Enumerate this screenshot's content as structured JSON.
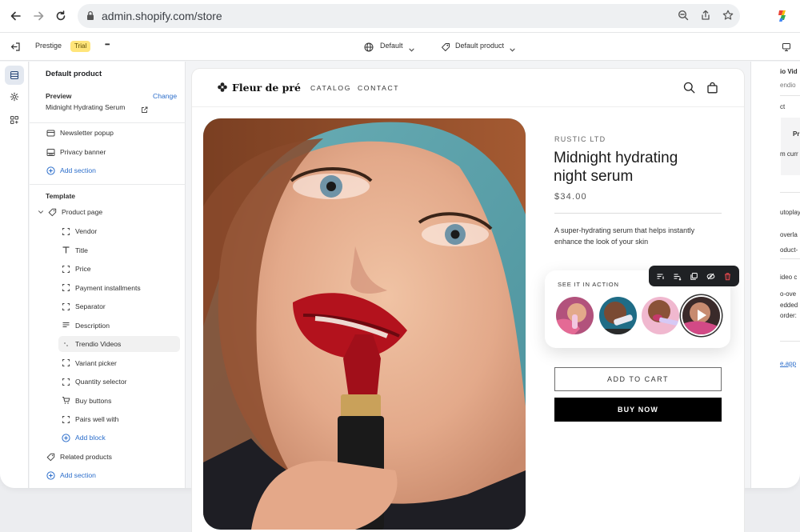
{
  "browser": {
    "url": "admin.shopify.com/store"
  },
  "toolbar": {
    "store_name": "Prestige",
    "trial_badge": "Trial",
    "more_label": "•••",
    "theme_select": "Default",
    "template_select": "Default product"
  },
  "sidebar": {
    "title": "Default product",
    "preview_label": "Preview",
    "change_link": "Change",
    "preview_product": "Midnight Hydrating Serum",
    "header_items": [
      {
        "label": "Newsletter popup",
        "icon": "popup-icon"
      },
      {
        "label": "Privacy banner",
        "icon": "banner-icon"
      }
    ],
    "add_section_1": "Add section",
    "template_heading": "Template",
    "product_page": "Product page",
    "blocks": [
      {
        "label": "Vendor",
        "icon": "block-frame-icon"
      },
      {
        "label": "Title",
        "icon": "text-icon"
      },
      {
        "label": "Price",
        "icon": "block-frame-icon"
      },
      {
        "label": "Payment installments",
        "icon": "block-frame-icon"
      },
      {
        "label": "Separator",
        "icon": "block-frame-icon"
      },
      {
        "label": "Description",
        "icon": "paragraph-icon"
      },
      {
        "label": "Trendio Videos",
        "icon": "app-block-icon",
        "selected": true
      },
      {
        "label": "Variant picker",
        "icon": "block-frame-icon"
      },
      {
        "label": "Quantity selector",
        "icon": "block-frame-icon"
      },
      {
        "label": "Buy buttons",
        "icon": "cart-icon"
      },
      {
        "label": "Pairs well with",
        "icon": "block-frame-icon"
      }
    ],
    "add_block": "Add block",
    "related_products": "Related products",
    "add_section_2": "Add section"
  },
  "store": {
    "brand": "Fleur de pré",
    "nav": [
      "CATALOG",
      "CONTACT"
    ],
    "vendor": "RUSTIC LTD",
    "title": "Midnight hydrating night serum",
    "price": "$34.00",
    "description": "A super-hydrating serum that helps instantly enhance the look of your skin",
    "videos_title": "SEE IT IN ACTION",
    "add_to_cart": "ADD TO CART",
    "buy_now": "BUY NOW"
  },
  "right_panel": {
    "lines": [
      "io Vid",
      "endio",
      "ct",
      "Pr",
      "m curr",
      "utoplay",
      "overla",
      "oduct-",
      "ideo c",
      "o-ove",
      "edded",
      "order:",
      "e.app"
    ]
  },
  "colors": {
    "accent_link": "#2c6ecb",
    "trial_badge": "#ffe57a",
    "buy_now_bg": "#000000",
    "floating_toolbar": "#1f2124",
    "delete_icon": "#e5484d",
    "photo_background": "#5fa4ad",
    "lipstick": "#b3121d"
  }
}
